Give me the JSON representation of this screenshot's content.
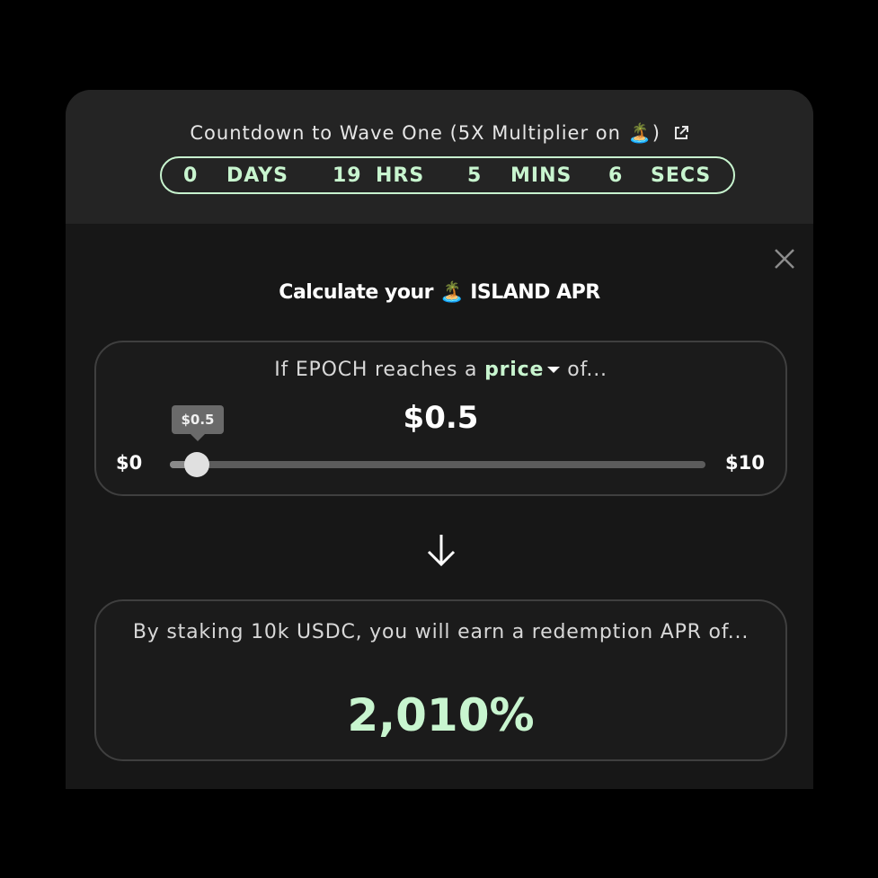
{
  "colors": {
    "accent": "#c8f5cf",
    "card_bg": "#171717",
    "header_bg": "#242424",
    "border": "#3f3f3f"
  },
  "countdown": {
    "title": "Countdown to Wave One (5X Multiplier on 🏝️)",
    "link_icon": "external-link-icon",
    "days_value": "0",
    "days_label": "DAYS",
    "hrs_value": "19",
    "hrs_label": "HRS",
    "mins_value": "5",
    "mins_label": "MINS",
    "secs_value": "6",
    "secs_label": "SECS"
  },
  "calculator": {
    "title": "Calculate your 🏝️ ISLAND APR",
    "close_icon": "close-icon"
  },
  "price_section": {
    "prefix": "If EPOCH reaches a ",
    "price_word": "price",
    "suffix": "of...",
    "current_value": "$0.5",
    "tooltip": "$0.5",
    "min_label": "$0",
    "max_label": "$10",
    "slider_fraction": 0.05
  },
  "result_section": {
    "text": "By staking 10k USDC, you will earn a redemption APR of...",
    "apr": "2,010%"
  }
}
